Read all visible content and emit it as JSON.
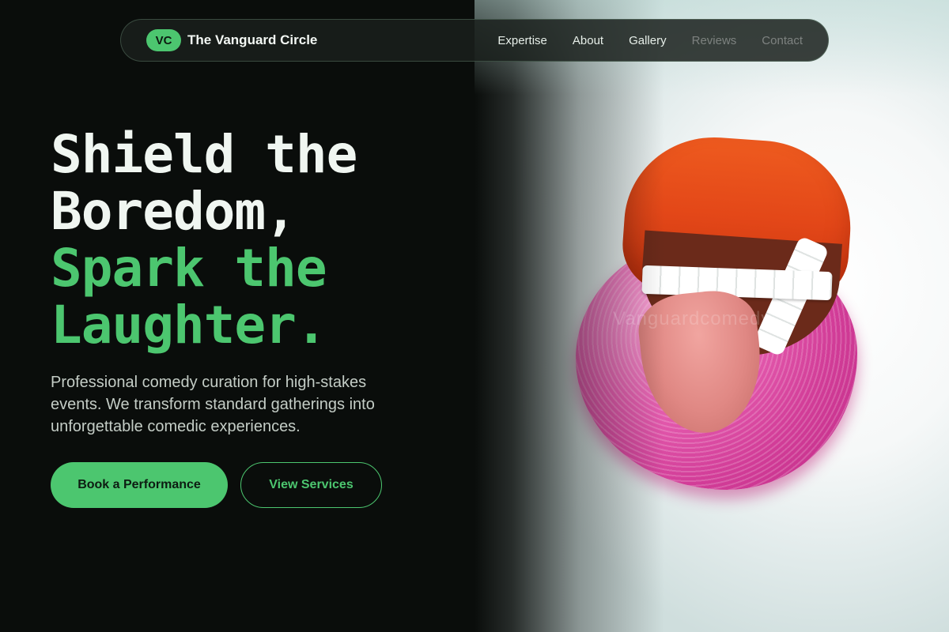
{
  "brand": {
    "badge": "VC",
    "name": "The Vanguard Circle"
  },
  "nav": {
    "items": [
      {
        "label": "Expertise"
      },
      {
        "label": "About"
      },
      {
        "label": "Gallery"
      },
      {
        "label": "Reviews"
      },
      {
        "label": "Contact"
      }
    ]
  },
  "hero": {
    "headline_line1": "Shield the",
    "headline_line2": "Boredom,",
    "headline_line3": "Spark the",
    "headline_line4": "Laughter.",
    "subtitle": "Professional comedy curation for high-stakes events. We transform standard gatherings into unforgettable comedic experiences.",
    "primary_button": "Book a Performance",
    "secondary_button": "View Services",
    "image_watermark": "Vanguardcomedy"
  },
  "colors": {
    "background": "#0a0d0b",
    "accent": "#4cc66f",
    "text": "#f0f6f1",
    "muted_text": "#c4cdc6"
  }
}
